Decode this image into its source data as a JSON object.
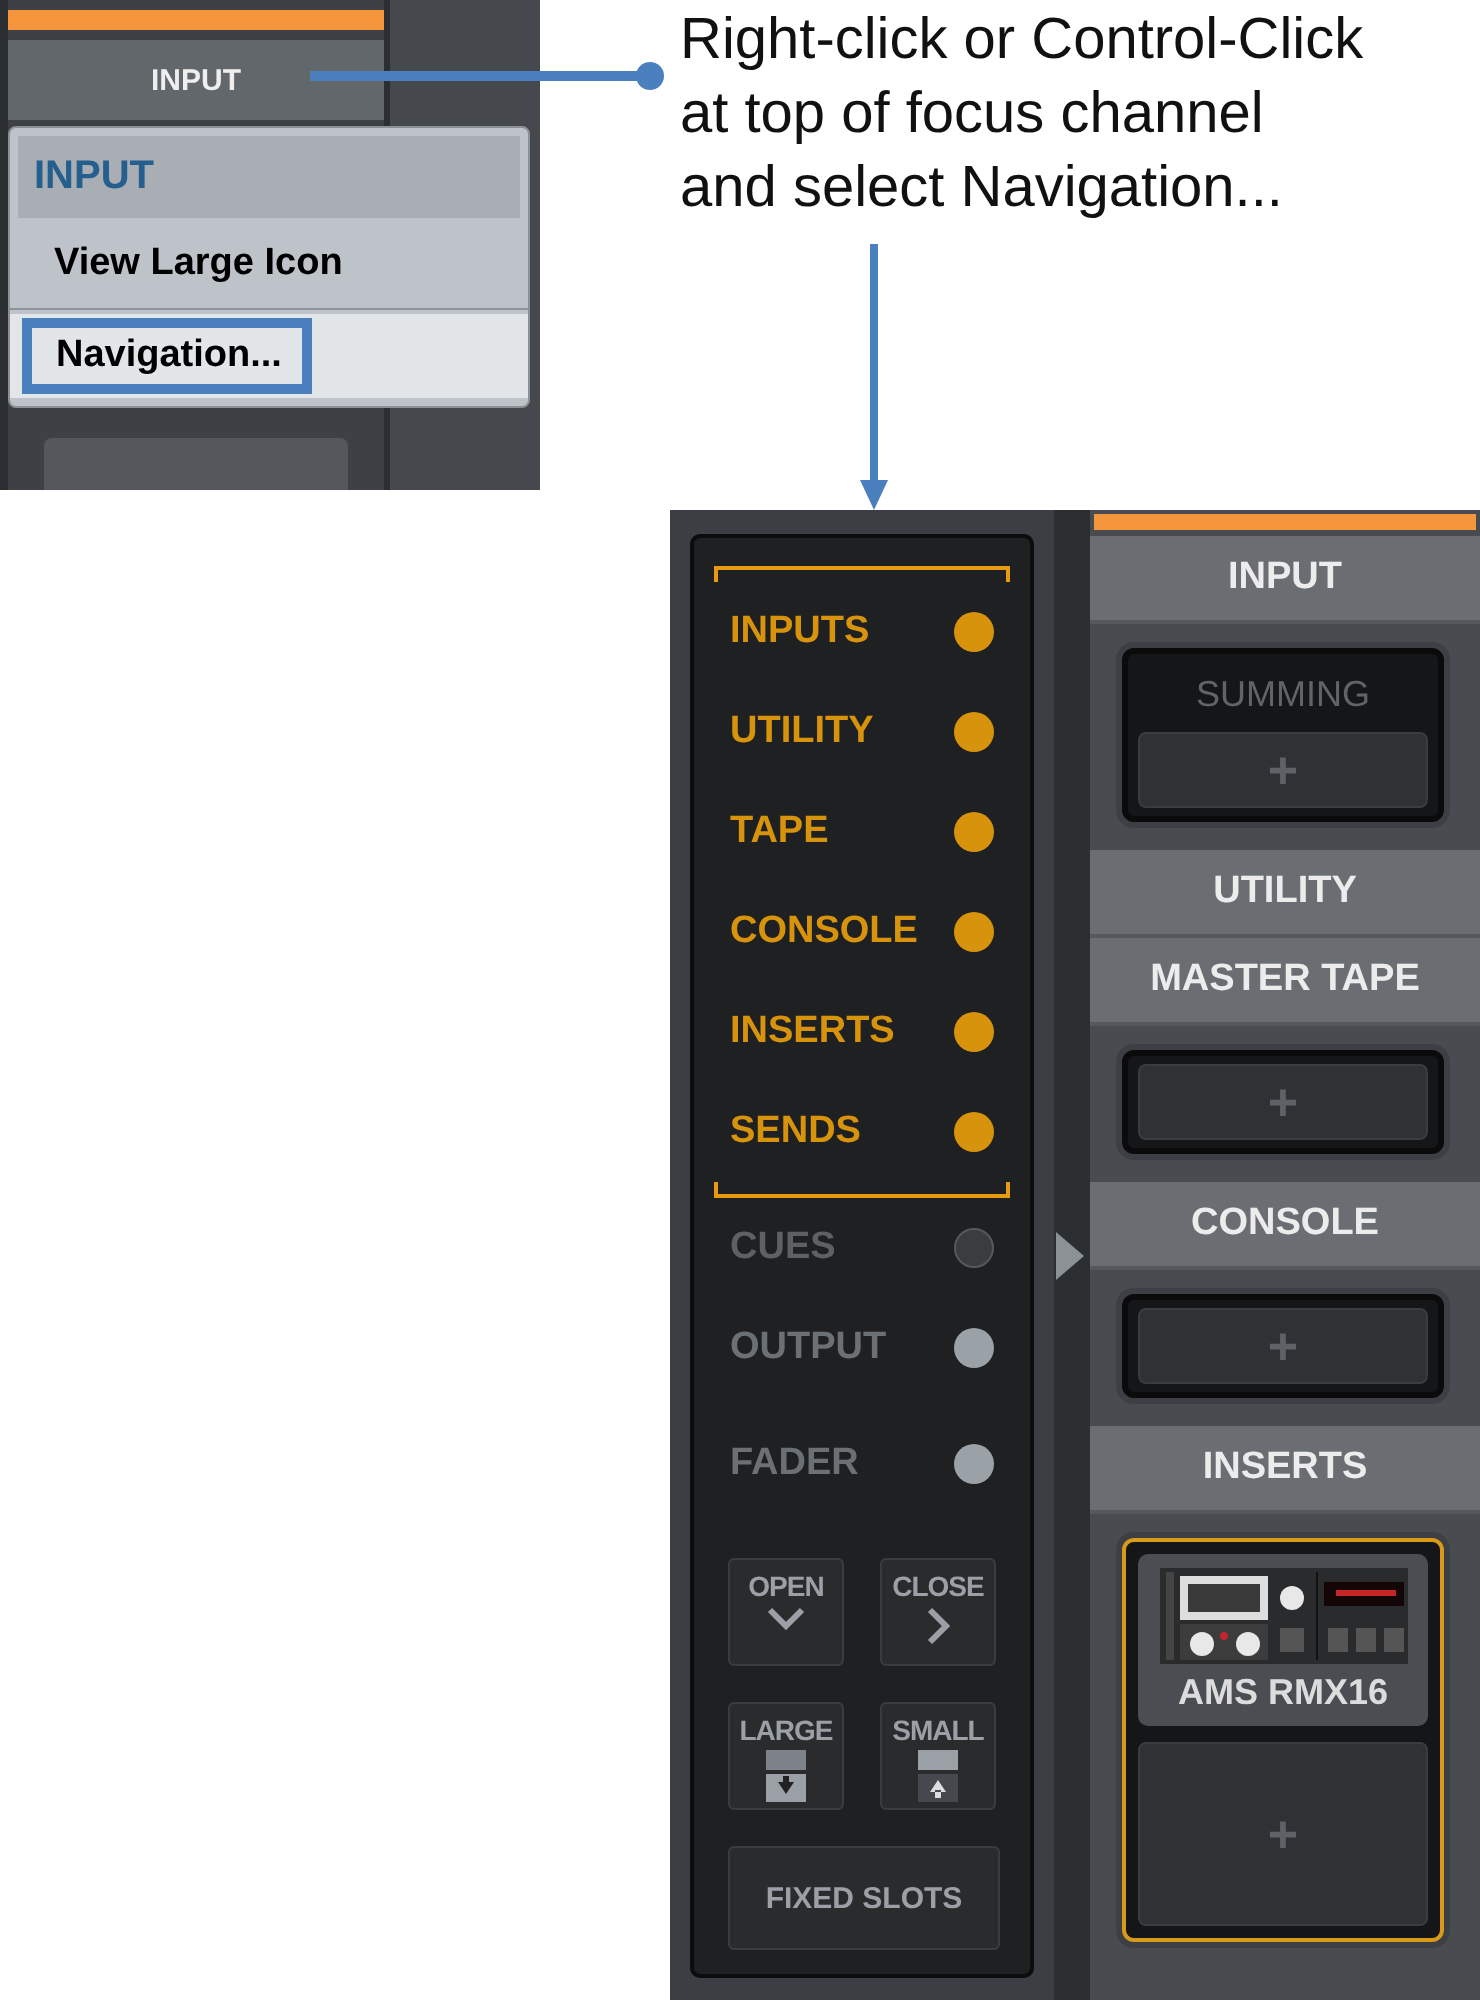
{
  "inset": {
    "channel_header": "INPUT",
    "menu": {
      "title": "INPUT",
      "items": [
        {
          "label": "View Large Icon",
          "selected": false
        },
        {
          "label": "Navigation...",
          "selected": true
        }
      ]
    }
  },
  "callout": {
    "lines": [
      "Right-click or Control-Click",
      "at top of focus channel",
      "and select Navigation..."
    ]
  },
  "navigation": {
    "items": [
      {
        "label": "INPUTS",
        "kind": "active"
      },
      {
        "label": "UTILITY",
        "kind": "active"
      },
      {
        "label": "TAPE",
        "kind": "active"
      },
      {
        "label": "CONSOLE",
        "kind": "active"
      },
      {
        "label": "INSERTS",
        "kind": "active"
      },
      {
        "label": "SENDS",
        "kind": "active"
      },
      {
        "label": "CUES",
        "kind": "empty"
      },
      {
        "label": "OUTPUT",
        "kind": "inactive"
      },
      {
        "label": "FADER",
        "kind": "inactive"
      }
    ],
    "buttons": [
      {
        "label": "OPEN",
        "kind": "open"
      },
      {
        "label": "CLOSE",
        "kind": "close"
      },
      {
        "label": "LARGE",
        "kind": "large"
      },
      {
        "label": "SMALL",
        "kind": "small"
      },
      {
        "label": "FIXED SLOTS",
        "kind": "wide"
      }
    ]
  },
  "channel": {
    "sections": [
      {
        "title": "INPUT",
        "box": {
          "highlighted": false,
          "slots": [
            {
              "kind": "label",
              "label": "SUMMING"
            },
            {
              "kind": "empty",
              "label": "+"
            }
          ]
        }
      },
      {
        "title": "UTILITY"
      },
      {
        "title": "MASTER TAPE",
        "box": {
          "highlighted": false,
          "slots": [
            {
              "kind": "empty",
              "label": "+"
            }
          ]
        }
      },
      {
        "title": "CONSOLE",
        "box": {
          "highlighted": false,
          "slots": [
            {
              "kind": "empty",
              "label": "+"
            }
          ]
        }
      },
      {
        "title": "INSERTS",
        "box": {
          "highlighted": true,
          "slots": [
            {
              "kind": "plugin",
              "label": "AMS RMX16"
            },
            {
              "kind": "empty",
              "label": "+"
            }
          ]
        }
      }
    ]
  }
}
